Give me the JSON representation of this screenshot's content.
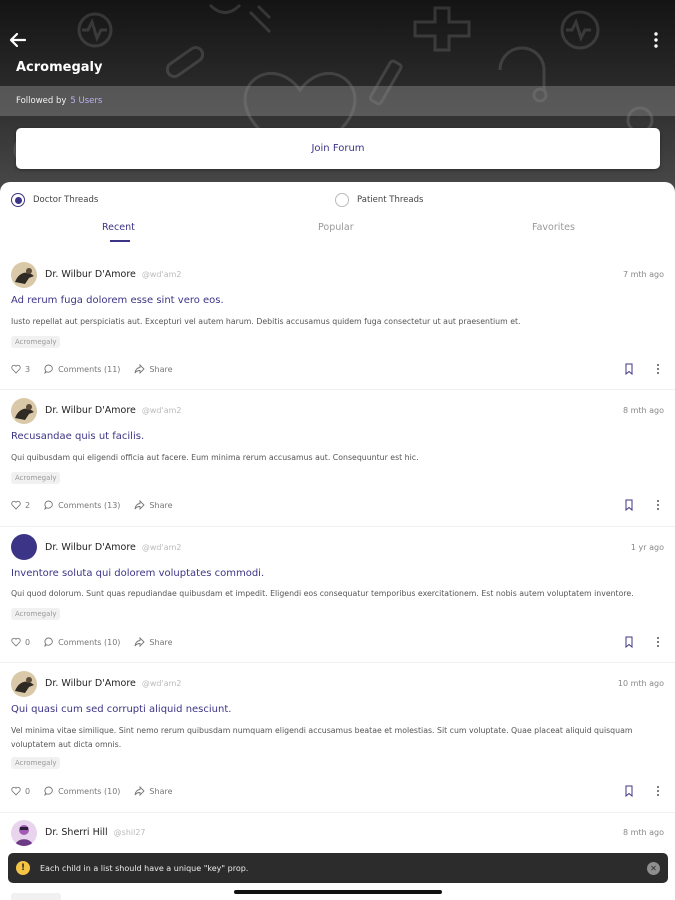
{
  "header": {
    "title": "Acromegaly",
    "followed_label": "Followed by",
    "followed_count": "5 Users",
    "join_label": "Join Forum"
  },
  "filters": {
    "doctor_label": "Doctor Threads",
    "patient_label": "Patient Threads",
    "selected": "Doctor Threads"
  },
  "tabs": [
    "Recent",
    "Popular",
    "Favorites"
  ],
  "active_tab": "Recent",
  "posts": [
    {
      "author": "Dr. Wilbur D'Amore",
      "handle": "@wd'am2",
      "time": "7 mth ago",
      "title": "Ad rerum fuga dolorem esse sint vero eos.",
      "body": "Iusto repellat aut perspiciatis aut. Excepturi vel autem harum. Debitis accusamus quidem fuga consectetur ut aut praesentium et.",
      "tag": "Acromegaly",
      "likes": "3",
      "comments": "Comments (11)",
      "share": "Share",
      "avatar": "photo"
    },
    {
      "author": "Dr. Wilbur D'Amore",
      "handle": "@wd'am2",
      "time": "8 mth ago",
      "title": "Recusandae quis ut facilis.",
      "body": "Qui quibusdam qui eligendi officia aut facere. Eum minima rerum accusamus aut. Consequuntur est hic.",
      "tag": "Acromegaly",
      "likes": "2",
      "comments": "Comments (13)",
      "share": "Share",
      "avatar": "photo"
    },
    {
      "author": "Dr. Wilbur D'Amore",
      "handle": "@wd'am2",
      "time": "1 yr ago",
      "title": "Inventore soluta qui dolorem voluptates commodi.",
      "body": "Qui quod dolorum. Sunt quas repudiandae quibusdam et impedit. Eligendi eos consequatur temporibus exercitationem. Est nobis autem voluptatem inventore.",
      "tag": "Acromegaly",
      "likes": "0",
      "comments": "Comments (10)",
      "share": "Share",
      "avatar": "solid"
    },
    {
      "author": "Dr. Wilbur D'Amore",
      "handle": "@wd'am2",
      "time": "10 mth ago",
      "title": "Qui quasi cum sed corrupti aliquid nesciunt.",
      "body": "Vel minima vitae similique. Sint nemo rerum quibusdam numquam eligendi accusamus beatae et molestias. Sit cum voluptate. Quae placeat aliquid quisquam voluptatem aut dicta omnis.",
      "tag": "Acromegaly",
      "likes": "0",
      "comments": "Comments (10)",
      "share": "Share",
      "avatar": "photo"
    },
    {
      "author": "Dr. Sherri Hill",
      "handle": "@shil27",
      "time": "8 mth ago",
      "avatar": "sherri"
    }
  ],
  "toast": {
    "icon": "!",
    "message": "Each child in a list should have a unique \"key\" prop.",
    "close": "✕"
  },
  "colors": {
    "accent": "#3c3486",
    "toast_bg": "#2c2c2c",
    "warning": "#f6c444"
  }
}
